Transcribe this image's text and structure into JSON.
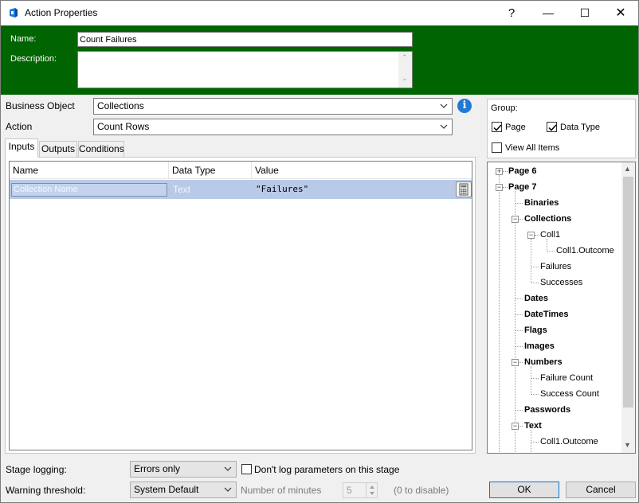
{
  "window": {
    "title": "Action Properties",
    "help_glyph": "?",
    "minimize_glyph": "—",
    "maximize_glyph": "☐",
    "close_glyph": "✕"
  },
  "header": {
    "name_label": "Name:",
    "name_value": "Count Failures",
    "description_label": "Description:",
    "description_value": ""
  },
  "form": {
    "business_object_label": "Business Object",
    "business_object_value": "Collections",
    "action_label": "Action",
    "action_value": "Count Rows",
    "info_glyph": "i"
  },
  "tabs": [
    {
      "label": "Inputs",
      "active": true
    },
    {
      "label": "Outputs",
      "active": false
    },
    {
      "label": "Conditions",
      "active": false
    }
  ],
  "grid": {
    "columns": [
      "Name",
      "Data Type",
      "Value"
    ],
    "rows": [
      {
        "name": "Collection Name",
        "data_type": "Text",
        "value": "\"Failures\""
      }
    ]
  },
  "group": {
    "label": "Group:",
    "page_label": "Page",
    "page_checked": true,
    "data_type_label": "Data Type",
    "data_type_checked": true,
    "view_all_label": "View All Items",
    "view_all_checked": false
  },
  "tree": [
    {
      "label": "Page 6",
      "bold": true
    },
    {
      "label": "Page 7",
      "bold": true
    },
    {
      "label": "Binaries",
      "bold": true
    },
    {
      "label": "Collections",
      "bold": true
    },
    {
      "label": "Coll1",
      "bold": false
    },
    {
      "label": "Coll1.Outcome",
      "bold": false
    },
    {
      "label": "Failures",
      "bold": false
    },
    {
      "label": "Successes",
      "bold": false
    },
    {
      "label": "Dates",
      "bold": true
    },
    {
      "label": "DateTimes",
      "bold": true
    },
    {
      "label": "Flags",
      "bold": true
    },
    {
      "label": "Images",
      "bold": true
    },
    {
      "label": "Numbers",
      "bold": true
    },
    {
      "label": "Failure Count",
      "bold": false
    },
    {
      "label": "Success Count",
      "bold": false
    },
    {
      "label": "Passwords",
      "bold": true
    },
    {
      "label": "Text",
      "bold": true
    },
    {
      "label": "Coll1.Outcome",
      "bold": false
    }
  ],
  "bottom": {
    "stage_logging_label": "Stage logging:",
    "stage_logging_value": "Errors only",
    "dont_log_label": "Don't log parameters on this stage",
    "dont_log_checked": false,
    "warning_label": "Warning threshold:",
    "warning_value": "System Default",
    "minutes_label": "Number of minutes",
    "minutes_value": "5",
    "disable_hint": "(0 to disable)",
    "ok_label": "OK",
    "cancel_label": "Cancel"
  },
  "colors": {
    "header_green": "#006400",
    "selection_blue": "#b8cae8",
    "info_blue": "#1f7ad6",
    "default_button_border": "#0078d7"
  }
}
